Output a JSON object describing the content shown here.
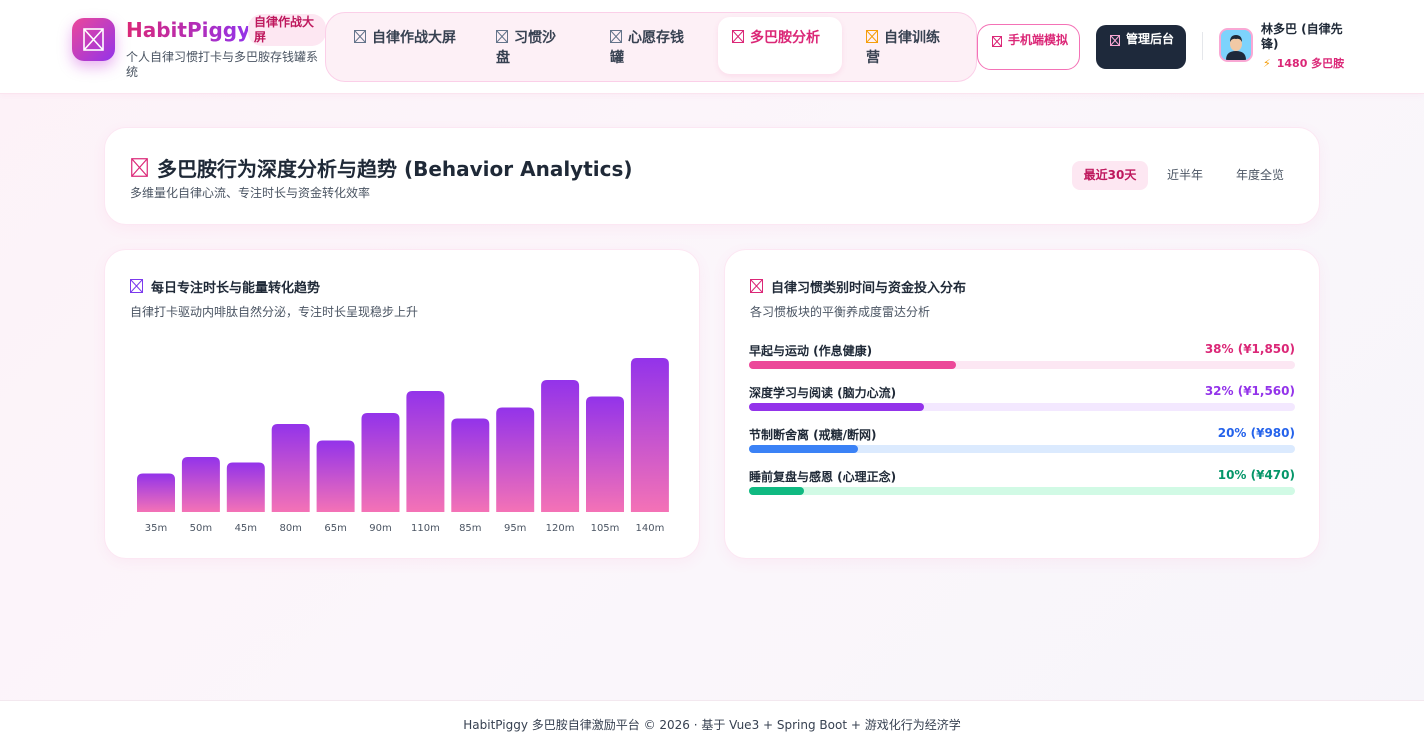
{
  "brand": {
    "name": "HabitPiggy",
    "badge": "自律作战大屏",
    "subtitle": "个人自律习惯打卡与多巴胺存钱罐系统"
  },
  "nav": {
    "items": [
      {
        "label": "自律作战大屏",
        "icon": "broken-image-icon",
        "active": false
      },
      {
        "label": "习惯沙盘",
        "icon": "broken-image-icon",
        "active": false
      },
      {
        "label": "心愿存钱罐",
        "icon": "broken-image-icon",
        "active": false
      },
      {
        "label": "多巴胺分析",
        "icon": "broken-image-icon",
        "active": true
      },
      {
        "label": "自律训练营",
        "icon": "broken-image-icon",
        "active": false
      }
    ]
  },
  "actions": {
    "mobile_label": "手机端模拟",
    "admin_label": "管理后台"
  },
  "user": {
    "name": "林多巴 (自律先锋)",
    "points": "1480 多巴胺"
  },
  "page": {
    "title": "多巴胺行为深度分析与趋势 (Behavior Analytics)",
    "subtitle": "多维量化自律心流、专注时长与资金转化效率",
    "ranges": [
      {
        "label": "最近30天",
        "active": true
      },
      {
        "label": "近半年",
        "active": false
      },
      {
        "label": "年度全览",
        "active": false
      }
    ]
  },
  "focus_card": {
    "title": "每日专注时长与能量转化趋势",
    "subtitle": "自律打卡驱动内啡肽自然分泌，专注时长呈现稳步上升"
  },
  "chart_data": {
    "type": "bar",
    "categories": [
      "35m",
      "50m",
      "45m",
      "80m",
      "65m",
      "90m",
      "110m",
      "85m",
      "95m",
      "120m",
      "105m",
      "140m"
    ],
    "values": [
      35,
      50,
      45,
      80,
      65,
      90,
      110,
      85,
      95,
      120,
      105,
      140
    ],
    "title": "每日专注时长与能量转化趋势",
    "xlabel": "",
    "ylabel": "",
    "ylim": [
      0,
      140
    ],
    "grid": false,
    "colors": {
      "top": "#9333ea",
      "bottom": "#f472b6"
    }
  },
  "dist_card": {
    "title": "自律习惯类别时间与资金投入分布",
    "subtitle": "各习惯板块的平衡养成度雷达分析",
    "items": [
      {
        "label": "早起与运动 (作息健康)",
        "value_text": "38% (¥1,850)",
        "percent": 38,
        "color": "#ec4899",
        "text_color": "#db2777",
        "track": "#fce7f3"
      },
      {
        "label": "深度学习与阅读 (脑力心流)",
        "value_text": "32% (¥1,560)",
        "percent": 32,
        "color": "#9333ea",
        "text_color": "#9333ea",
        "track": "#f3e8ff"
      },
      {
        "label": "节制断舍离 (戒糖/断网)",
        "value_text": "20% (¥980)",
        "percent": 20,
        "color": "#3b82f6",
        "text_color": "#2563eb",
        "track": "#dbeafe"
      },
      {
        "label": "睡前复盘与感恩 (心理正念)",
        "value_text": "10% (¥470)",
        "percent": 10,
        "color": "#10b981",
        "text_color": "#059669",
        "track": "#d1fae5"
      }
    ]
  },
  "footer": {
    "text": "HabitPiggy 多巴胺自律激励平台 © 2026 · 基于 Vue3 + Spring Boot + 游戏化行为经济学"
  }
}
